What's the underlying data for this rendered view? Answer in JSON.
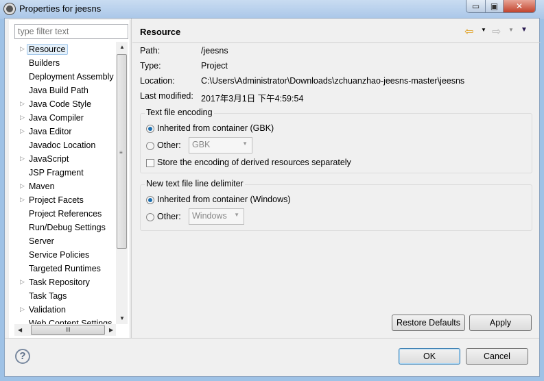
{
  "window": {
    "title": "Properties for jeesns",
    "minimize": "▭",
    "maximize": "▣",
    "close": "✕"
  },
  "filter": {
    "placeholder": "type filter text"
  },
  "tree": [
    {
      "label": "Resource",
      "expandable": true,
      "selected": true
    },
    {
      "label": "Builders",
      "expandable": false
    },
    {
      "label": "Deployment Assembly",
      "expandable": false
    },
    {
      "label": "Java Build Path",
      "expandable": false
    },
    {
      "label": "Java Code Style",
      "expandable": true
    },
    {
      "label": "Java Compiler",
      "expandable": true
    },
    {
      "label": "Java Editor",
      "expandable": true
    },
    {
      "label": "Javadoc Location",
      "expandable": false
    },
    {
      "label": "JavaScript",
      "expandable": true
    },
    {
      "label": "JSP Fragment",
      "expandable": false
    },
    {
      "label": "Maven",
      "expandable": true
    },
    {
      "label": "Project Facets",
      "expandable": true
    },
    {
      "label": "Project References",
      "expandable": false
    },
    {
      "label": "Run/Debug Settings",
      "expandable": false
    },
    {
      "label": "Server",
      "expandable": false
    },
    {
      "label": "Service Policies",
      "expandable": false
    },
    {
      "label": "Targeted Runtimes",
      "expandable": false
    },
    {
      "label": "Task Repository",
      "expandable": true
    },
    {
      "label": "Task Tags",
      "expandable": false
    },
    {
      "label": "Validation",
      "expandable": true
    },
    {
      "label": "Web Content Settings",
      "expandable": false
    }
  ],
  "page": {
    "title": "Resource",
    "nav": {
      "back": "⇦",
      "forward": "⇨",
      "menu": "▼",
      "dropdown": "▾"
    },
    "info": [
      {
        "label": "Path:",
        "value": "/jeesns"
      },
      {
        "label": "Type:",
        "value": "Project"
      },
      {
        "label": "Location:",
        "value": "C:\\Users\\Administrator\\Downloads\\zchuanzhao-jeesns-master\\jeesns"
      },
      {
        "label": "Last modified:",
        "value": "2017年3月1日 下午4:59:54"
      }
    ],
    "encoding": {
      "title": "Text file encoding",
      "inherited": "Inherited from container (GBK)",
      "other": "Other:",
      "other_value": "GBK",
      "store_derived": "Store the encoding of derived resources separately",
      "selected": "inherited",
      "store_checked": false
    },
    "delimiter": {
      "title": "New text file line delimiter",
      "inherited": "Inherited from container (Windows)",
      "other": "Other:",
      "other_value": "Windows",
      "selected": "inherited"
    },
    "restore_defaults": "Restore Defaults",
    "apply": "Apply"
  },
  "footer": {
    "help": "?",
    "ok": "OK",
    "cancel": "Cancel"
  },
  "colors": {
    "accent": "#1c6fb0",
    "back_arrow": "#e0a020"
  }
}
